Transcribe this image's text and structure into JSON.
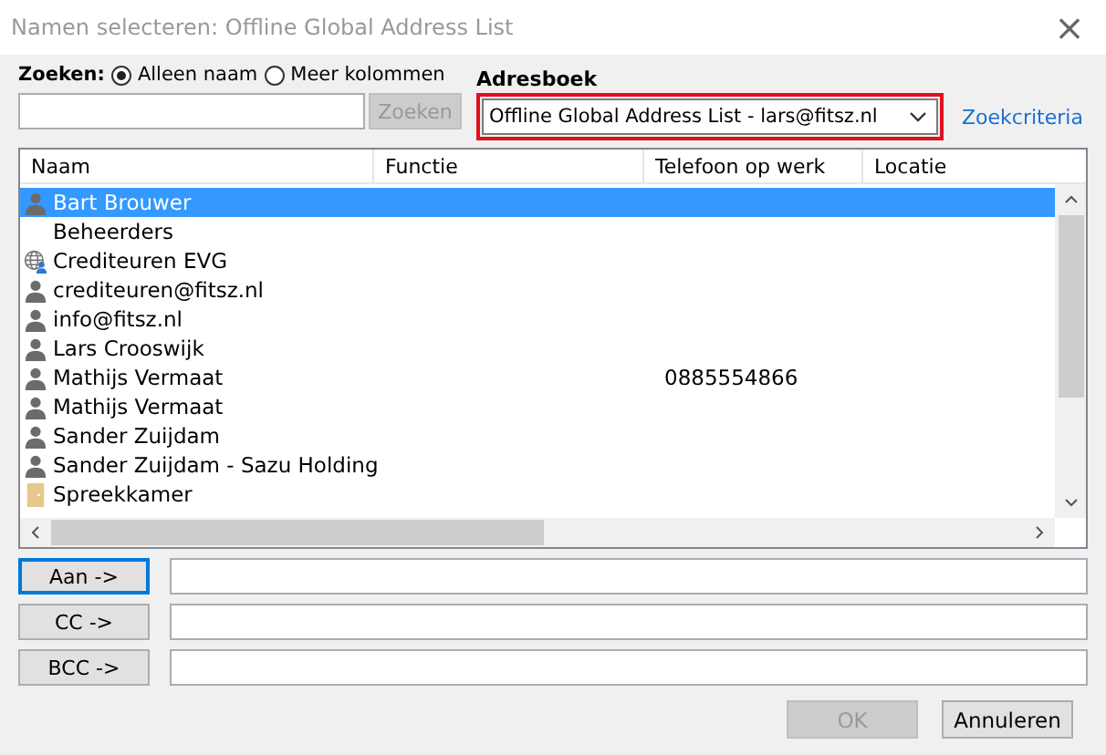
{
  "window": {
    "title": "Namen selecteren: Offline Global Address List",
    "close": "×"
  },
  "search": {
    "label": "Zoeken:",
    "options": [
      {
        "label": "Alleen naam",
        "selected": true
      },
      {
        "label": "Meer kolommen",
        "selected": false
      }
    ],
    "button": {
      "label": "Zoeken",
      "disabled": true
    }
  },
  "address_book": {
    "label": "Adresboek",
    "value": "Offline Global Address List - lars@fitsz.nl",
    "highlighted": true,
    "link": "Zoekcriteria"
  },
  "table": {
    "columns": [
      "Naam",
      "Functie",
      "Telefoon op werk",
      "Locatie"
    ],
    "rows": [
      {
        "kind": "person",
        "name": "Bart Brouwer",
        "selected": true
      },
      {
        "kind": "none",
        "name": "Beheerders",
        "selected": false
      },
      {
        "kind": "globe",
        "name": "Crediteuren EVG",
        "selected": false
      },
      {
        "kind": "person",
        "name": "crediteuren@fitsz.nl",
        "selected": false
      },
      {
        "kind": "person",
        "name": "info@fitsz.nl",
        "selected": false
      },
      {
        "kind": "person",
        "name": "Lars Crooswijk",
        "selected": false
      },
      {
        "kind": "person",
        "name": "Mathijs Vermaat",
        "phone": "0885554866",
        "selected": false
      },
      {
        "kind": "person",
        "name": "Mathijs Vermaat",
        "selected": false
      },
      {
        "kind": "person",
        "name": "Sander Zuijdam",
        "selected": false
      },
      {
        "kind": "person",
        "name": "Sander Zuijdam - Sazu Holding",
        "selected": false
      },
      {
        "kind": "room",
        "name": "Spreekkamer",
        "selected": false
      }
    ]
  },
  "recipients": [
    {
      "button": "Aan ->",
      "focused": true
    },
    {
      "button": "CC ->",
      "focused": false
    },
    {
      "button": "BCC ->",
      "focused": false
    }
  ],
  "buttons": [
    {
      "label": "OK",
      "disabled": true
    },
    {
      "label": "Annuleren",
      "disabled": false
    }
  ]
}
